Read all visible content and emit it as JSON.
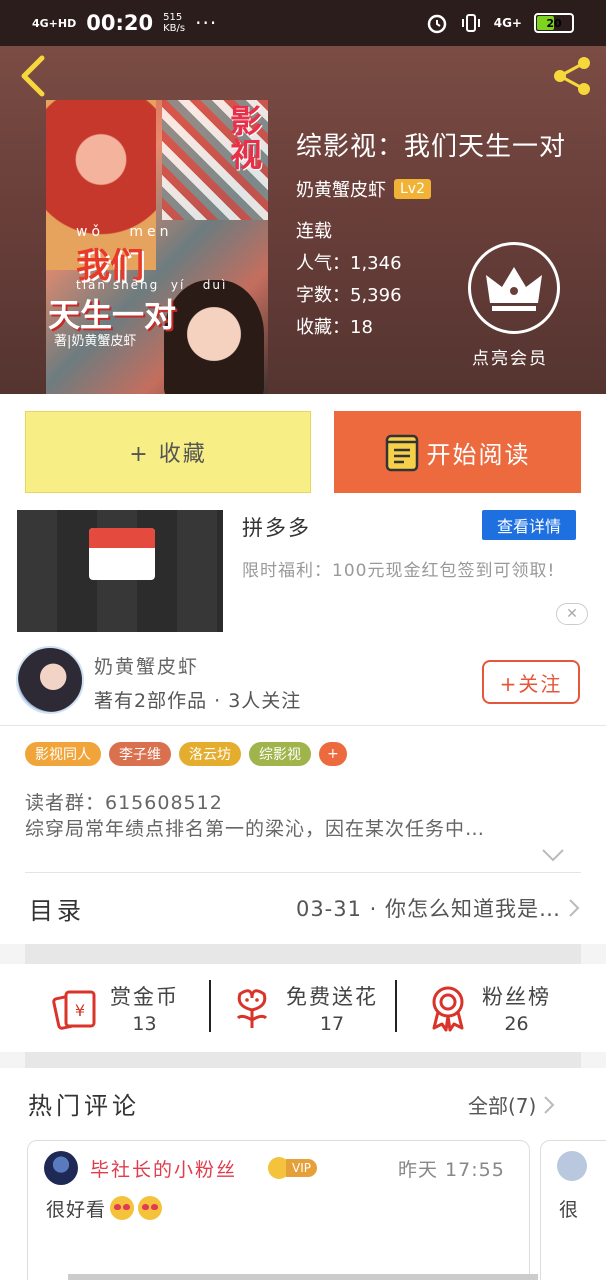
{
  "status_bar": {
    "network": "4G+HD",
    "time": "00:20",
    "speed": "515",
    "speed_unit": "KB/s",
    "dots": "···",
    "net_right": "4G+",
    "battery": "20"
  },
  "header": {
    "title": "综影视：我们天生一对",
    "author": "奶黄蟹皮虾",
    "level": "Lv2",
    "status": "连载",
    "popularity_label": "人气：",
    "popularity": "1,346",
    "words_label": "字数：",
    "words": "5,396",
    "favorites_label": "收藏：",
    "favorites": "18",
    "vip_label": "点亮会员",
    "cover": {
      "ying": "影\n视",
      "women_pinyin": "wǒ   men",
      "women": "我们",
      "tian_pinyin": "tiān shēng  yí   duì",
      "tian": "天生一对",
      "author": "著|奶黄蟹皮虾"
    }
  },
  "actions": {
    "collect": "+ 收藏",
    "read": "开始阅读"
  },
  "ad": {
    "title": "拼多多",
    "detail": "查看详情",
    "desc": "限时福利：100元现金红包签到可领取!",
    "close": "✕"
  },
  "author_card": {
    "name": "奶黄蟹皮虾",
    "stats": "著有2部作品 · 3人关注",
    "follow": "+关注"
  },
  "tags": [
    {
      "label": "影视同人",
      "color": "#f0a43a"
    },
    {
      "label": "李子维",
      "color": "#d9704e"
    },
    {
      "label": "洛云坊",
      "color": "#e5ad2e"
    },
    {
      "label": "综影视",
      "color": "#9fb44a"
    },
    {
      "label": "+",
      "color": "#ec6a3e"
    }
  ],
  "intro": {
    "line1": "读者群：615608512",
    "line2": "综穿局常年绩点排名第一的梁沁，因在某次任务中…"
  },
  "toc": {
    "label": "目录",
    "latest": "03-31 · 你怎么知道我是…"
  },
  "rewards": [
    {
      "label": "赏金币",
      "value": "13",
      "icon": "coin-envelope-icon"
    },
    {
      "label": "免费送花",
      "value": "17",
      "icon": "flower-icon"
    },
    {
      "label": "粉丝榜",
      "value": "26",
      "icon": "medal-icon"
    }
  ],
  "comments": {
    "title": "热门评论",
    "all": "全部(7)",
    "items": [
      {
        "user": "毕社长的小粉丝",
        "badge": "VIP",
        "time": "昨天 17:55",
        "text": "很好看"
      },
      {
        "text": "很"
      }
    ]
  },
  "colors": {
    "accent": "#ec6a3e",
    "collect_bg": "#f7ef85",
    "ad_button": "#1e6fe0",
    "username": "#e03c4c"
  }
}
